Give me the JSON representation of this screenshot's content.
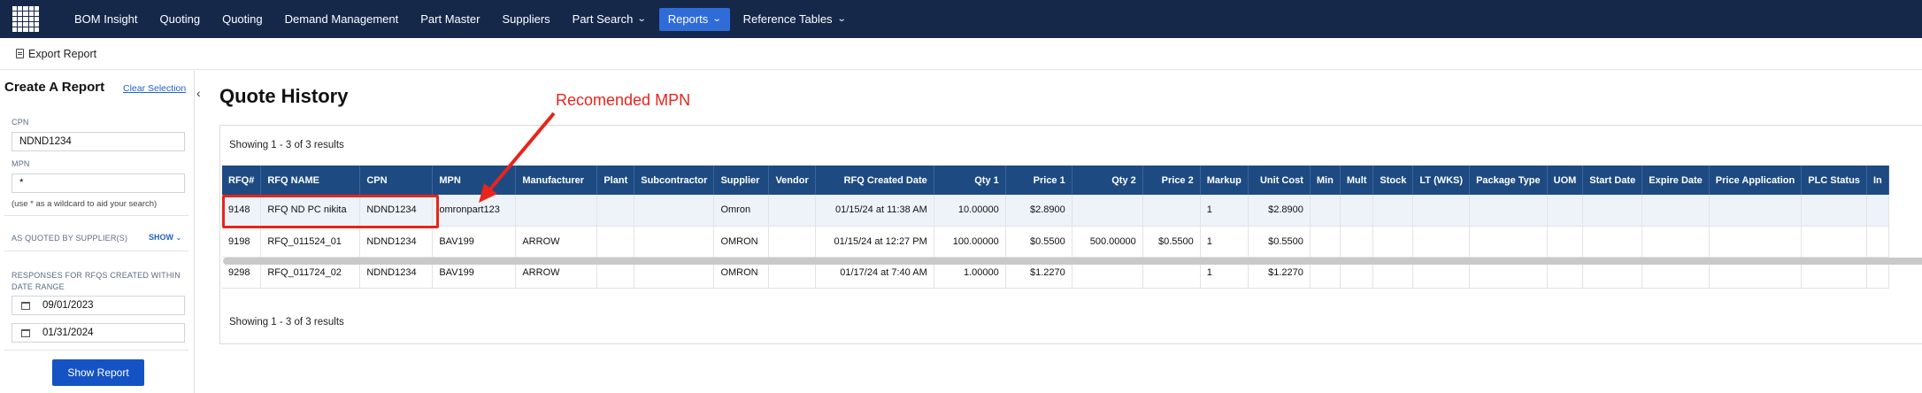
{
  "nav": {
    "items": [
      {
        "label": "BOM Insight"
      },
      {
        "label": "Quoting"
      },
      {
        "label": "Quoting"
      },
      {
        "label": "Demand Management"
      },
      {
        "label": "Part Master"
      },
      {
        "label": "Suppliers"
      },
      {
        "label": "Part Search"
      },
      {
        "label": "Reports"
      },
      {
        "label": "Reference Tables"
      }
    ],
    "active": "Reports",
    "accent_color": "#2f6cd8",
    "bar_color": "#16284a"
  },
  "toolbar": {
    "export_label": "Export Report"
  },
  "sidebar": {
    "title": "Create A Report",
    "clear_label": "Clear Selection",
    "cpn_label": "CPN",
    "cpn_value": "NDND1234",
    "mpn_label": "MPN",
    "mpn_value": "*",
    "hint": "(use * as a wildcard to aid your search)",
    "supplier_label": "AS QUOTED BY SUPPLIER(S)",
    "show_label": "SHOW",
    "range_label": "RESPONSES FOR RFQS CREATED WITHIN DATE RANGE",
    "date_from": "09/01/2023",
    "date_to": "01/31/2024",
    "submit_label": "Show Report"
  },
  "main": {
    "title": "Quote History",
    "showing_top": "Showing 1 - 3 of 3 results",
    "showing_bottom": "Showing 1 - 3 of 3 results",
    "columns": [
      "RFQ#",
      "RFQ NAME",
      "CPN",
      "MPN",
      "Manufacturer",
      "Plant",
      "Subcontractor",
      "Supplier",
      "Vendor",
      "RFQ Created Date",
      "Qty 1",
      "Price 1",
      "Qty 2",
      "Price 2",
      "Markup",
      "Unit Cost",
      "Min",
      "Mult",
      "Stock",
      "LT (WKS)",
      "Package Type",
      "UOM",
      "Start Date",
      "Expire Date",
      "Price Application",
      "PLC Status",
      "In"
    ],
    "rows": [
      [
        "9148",
        "RFQ ND PC nikita",
        "NDND1234",
        "omronpart123",
        "",
        "",
        "",
        "Omron",
        "",
        "01/15/24 at 11:38 AM",
        "10.00000",
        "$2.8900",
        "",
        "",
        "1",
        "$2.8900",
        "",
        "",
        "",
        "",
        "",
        "",
        "",
        "",
        "",
        "",
        ""
      ],
      [
        "9198",
        "RFQ_011524_01",
        "NDND1234",
        "BAV199",
        "ARROW",
        "",
        "",
        "OMRON",
        "",
        "01/15/24 at 12:27 PM",
        "100.00000",
        "$0.5500",
        "500.00000",
        "$0.5500",
        "1",
        "$0.5500",
        "",
        "",
        "",
        "",
        "",
        "",
        "",
        "",
        "",
        "",
        ""
      ],
      [
        "9298",
        "RFQ_011724_02",
        "NDND1234",
        "BAV199",
        "ARROW",
        "",
        "",
        "OMRON",
        "",
        "01/17/24 at 7:40 AM",
        "1.00000",
        "$1.2270",
        "",
        "",
        "1",
        "$1.2270",
        "",
        "",
        "",
        "",
        "",
        "",
        "",
        "",
        "",
        "",
        ""
      ]
    ]
  },
  "annotation": {
    "label": "Recomended MPN",
    "color": "#e8241b"
  }
}
